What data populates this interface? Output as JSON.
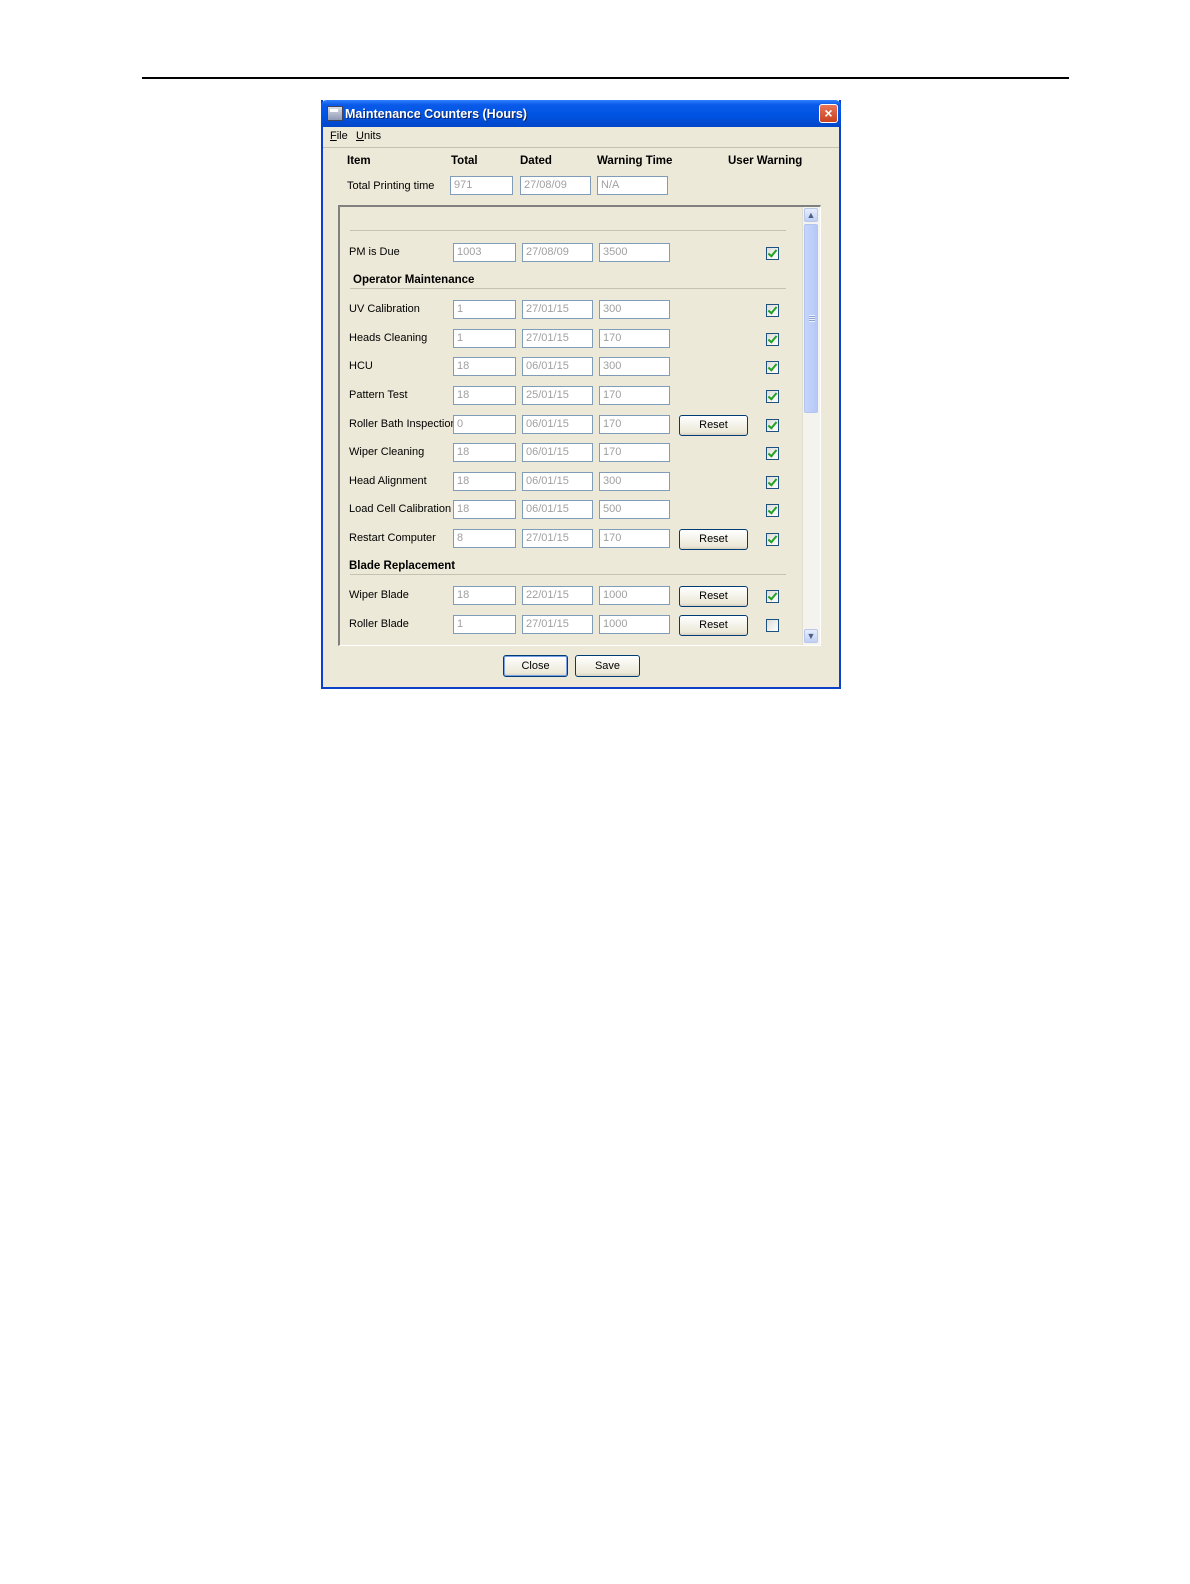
{
  "window": {
    "title": "Maintenance Counters (Hours)",
    "close_glyph": "×"
  },
  "menu": {
    "file": "File",
    "units": "Units"
  },
  "columns": {
    "item": "Item",
    "total": "Total",
    "dated": "Dated",
    "warning_time": "Warning Time",
    "user_warning": "User Warning"
  },
  "total_printing": {
    "label": "Total Printing time",
    "total": "971",
    "dated": "27/08/09",
    "warning": "N/A"
  },
  "reset_label": "Reset",
  "sections": {
    "operator": "Operator Maintenance",
    "blade": "Blade Replacement"
  },
  "rows": [
    {
      "label": "PM is Due",
      "total": "1003",
      "dated": "27/08/09",
      "warning": "3500",
      "reset": false,
      "checked": true
    },
    {
      "label": "UV Calibration",
      "total": "1",
      "dated": "27/01/15",
      "warning": "300",
      "reset": false,
      "checked": true
    },
    {
      "label": "Heads Cleaning",
      "total": "1",
      "dated": "27/01/15",
      "warning": "170",
      "reset": false,
      "checked": true
    },
    {
      "label": "HCU",
      "total": "18",
      "dated": "06/01/15",
      "warning": "300",
      "reset": false,
      "checked": true
    },
    {
      "label": "Pattern Test",
      "total": "18",
      "dated": "25/01/15",
      "warning": "170",
      "reset": false,
      "checked": true
    },
    {
      "label": "Roller Bath Inspection",
      "total": "0",
      "dated": "06/01/15",
      "warning": "170",
      "reset": true,
      "checked": true
    },
    {
      "label": "Wiper Cleaning",
      "total": "18",
      "dated": "06/01/15",
      "warning": "170",
      "reset": false,
      "checked": true
    },
    {
      "label": "Head Alignment",
      "total": "18",
      "dated": "06/01/15",
      "warning": "300",
      "reset": false,
      "checked": true
    },
    {
      "label": "Load Cell Calibration",
      "total": "18",
      "dated": "06/01/15",
      "warning": "500",
      "reset": false,
      "checked": true
    },
    {
      "label": "Restart Computer",
      "total": "8",
      "dated": "27/01/15",
      "warning": "170",
      "reset": true,
      "checked": true
    },
    {
      "label": "Wiper Blade",
      "total": "18",
      "dated": "22/01/15",
      "warning": "1000",
      "reset": true,
      "checked": true
    },
    {
      "label": "Roller Blade",
      "total": "1",
      "dated": "27/01/15",
      "warning": "1000",
      "reset": true,
      "checked": false
    }
  ],
  "buttons": {
    "close": "Close",
    "save": "Save"
  },
  "icons": {
    "scroll_up": "scroll-up-arrow-icon",
    "scroll_down": "scroll-down-arrow-icon",
    "app": "counter-window-icon"
  },
  "colors": {
    "titlebar": "#0054e3",
    "dialog_bg": "#ece9d8",
    "check": "#21a121"
  }
}
